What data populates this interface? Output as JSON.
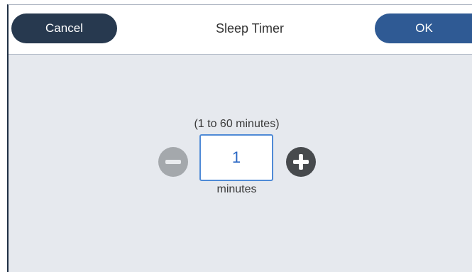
{
  "header": {
    "cancel_label": "Cancel",
    "title": "Sleep Timer",
    "ok_label": "OK"
  },
  "timer": {
    "range_label": "(1 to 60 minutes)",
    "value": "1",
    "unit_label": "minutes",
    "minus_icon": "minus-circle-icon",
    "plus_icon": "plus-circle-icon"
  },
  "colors": {
    "cancel_button": "#27394f",
    "ok_button": "#2f5a94",
    "background": "#e6e9ee",
    "value_text": "#2a67c4",
    "minus_disabled": "#a4a8ac",
    "plus_enabled": "#474a4d"
  }
}
